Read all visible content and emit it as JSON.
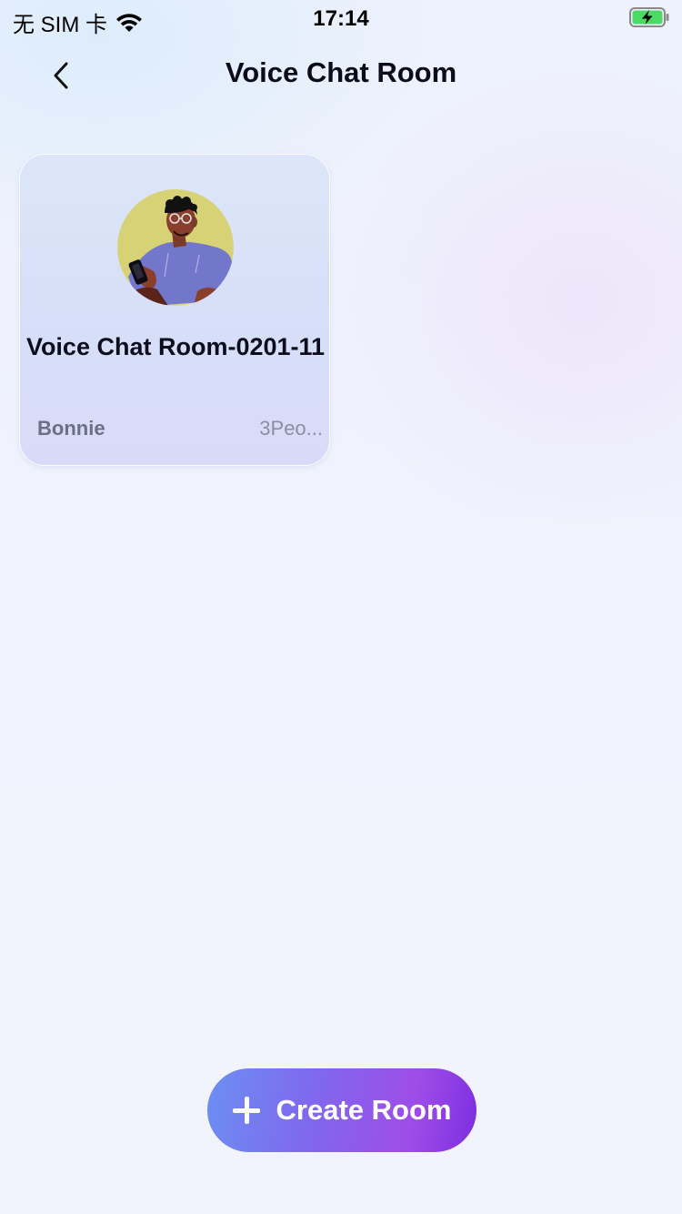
{
  "status_bar": {
    "carrier": "无 SIM 卡",
    "time": "17:14",
    "battery_icon": "battery-charging-icon",
    "wifi_icon": "wifi-icon"
  },
  "nav": {
    "title": "Voice Chat Room",
    "back_icon": "chevron-left-icon"
  },
  "rooms": [
    {
      "name": "Voice Chat Room-0201-11",
      "owner": "Bonnie",
      "people": "3Peo...",
      "avatar_icon": "avatar-illustration"
    }
  ],
  "create_button": {
    "label": "Create Room",
    "icon": "plus-icon"
  },
  "colors": {
    "accent_start": "#6c8ff2",
    "accent_end": "#7c2ee0",
    "card_bg": "#d9e1f8"
  }
}
